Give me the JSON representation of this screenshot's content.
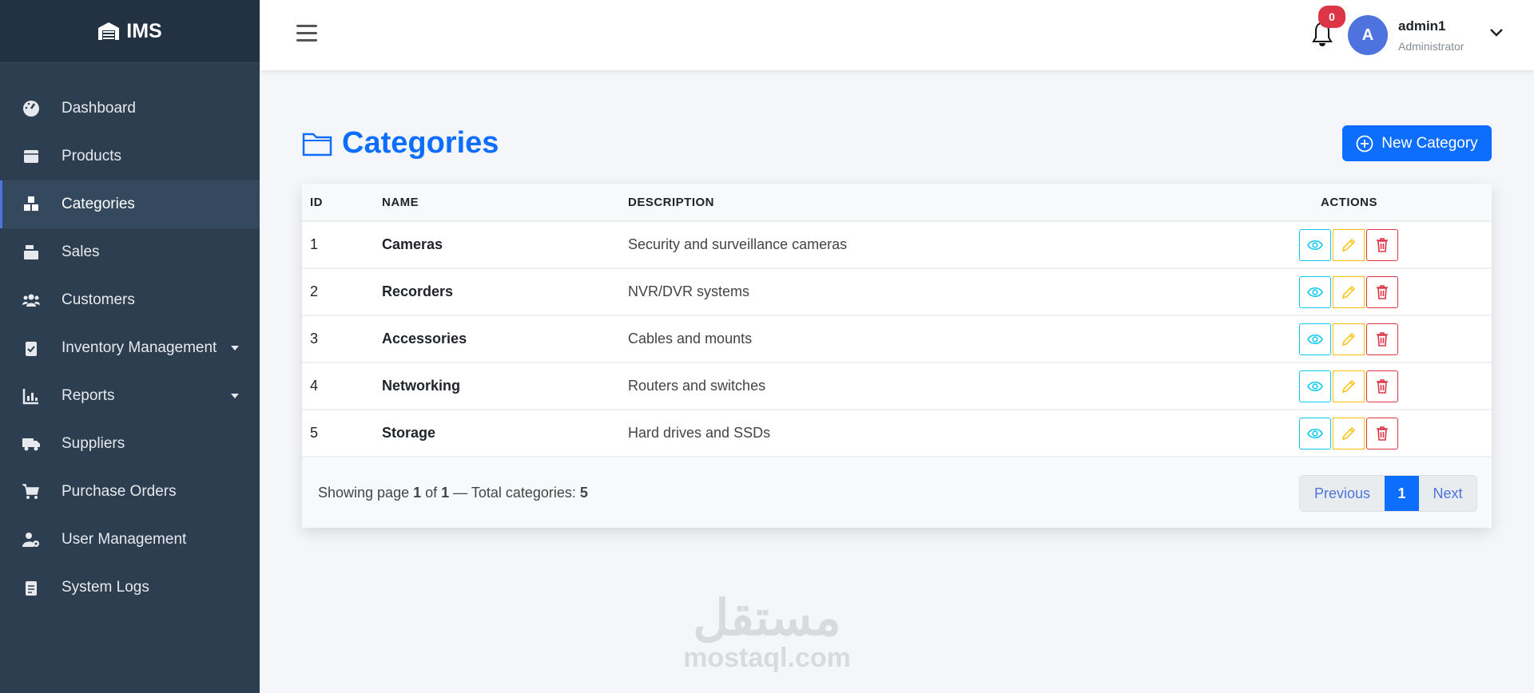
{
  "brand": {
    "name": "IMS"
  },
  "sidebar": {
    "items": [
      {
        "label": "Dashboard",
        "icon": "gauge-icon"
      },
      {
        "label": "Products",
        "icon": "box-icon"
      },
      {
        "label": "Categories",
        "icon": "cubes-icon",
        "active": true
      },
      {
        "label": "Sales",
        "icon": "cash-register-icon"
      },
      {
        "label": "Customers",
        "icon": "users-icon"
      },
      {
        "label": "Inventory Management",
        "icon": "clipboard-check-icon",
        "dropdown": true
      },
      {
        "label": "Reports",
        "icon": "chart-icon",
        "dropdown": true
      },
      {
        "label": "Suppliers",
        "icon": "truck-icon"
      },
      {
        "label": "Purchase Orders",
        "icon": "cart-icon"
      },
      {
        "label": "User Management",
        "icon": "user-gear-icon"
      },
      {
        "label": "System Logs",
        "icon": "clipboard-list-icon"
      }
    ]
  },
  "header": {
    "notifications": "0",
    "avatar_letter": "A",
    "user_name": "admin1",
    "user_role": "Administrator"
  },
  "page": {
    "title": "Categories",
    "new_button": "New Category"
  },
  "table": {
    "columns": [
      "ID",
      "NAME",
      "DESCRIPTION",
      "ACTIONS"
    ],
    "rows": [
      {
        "id": "1",
        "name": "Cameras",
        "description": "Security and surveillance cameras"
      },
      {
        "id": "2",
        "name": "Recorders",
        "description": "NVR/DVR systems"
      },
      {
        "id": "3",
        "name": "Accessories",
        "description": "Cables and mounts"
      },
      {
        "id": "4",
        "name": "Networking",
        "description": "Routers and switches"
      },
      {
        "id": "5",
        "name": "Storage",
        "description": "Hard drives and SSDs"
      }
    ]
  },
  "footer": {
    "showing_prefix": "Showing page ",
    "page": "1",
    "of": " of ",
    "pages": "1",
    "total_label": " — Total categories: ",
    "total": "5"
  },
  "pagination": {
    "previous": "Previous",
    "current": "1",
    "next": "Next"
  },
  "watermark": {
    "arabic": "مستقل",
    "latin": "mostaql.com"
  },
  "colors": {
    "primary": "#0d6efd",
    "sidebar": "#2c3e50",
    "info": "#0dcaf0",
    "warning": "#ffc107",
    "danger": "#dc3545"
  }
}
